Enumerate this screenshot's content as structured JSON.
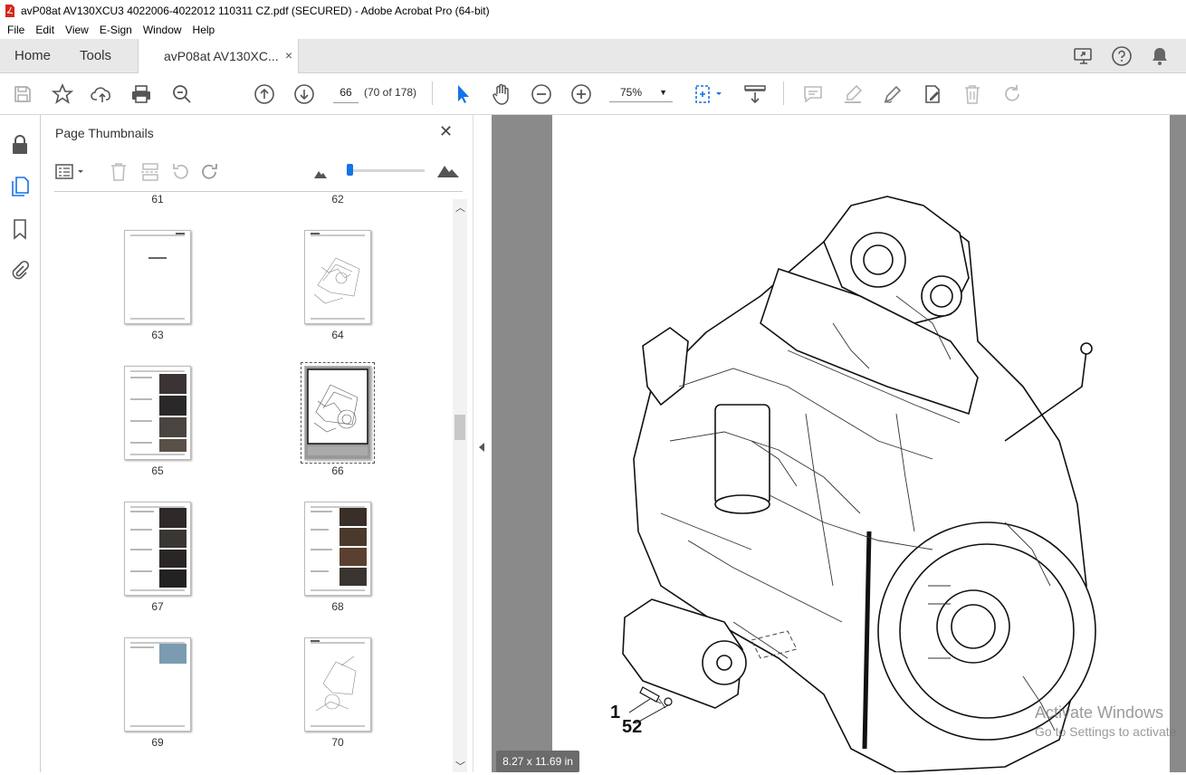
{
  "window": {
    "title": "avP08at AV130XCU3 4022006-4022012 110311 CZ.pdf (SECURED) - Adobe Acrobat Pro (64-bit)"
  },
  "menu": [
    "File",
    "Edit",
    "View",
    "E-Sign",
    "Window",
    "Help"
  ],
  "tabs": {
    "home": "Home",
    "tools": "Tools",
    "doc": "avP08at AV130XC...",
    "close": "×"
  },
  "toolbar": {
    "page_number": "66",
    "page_of": "(70 of 178)",
    "zoom": "75%"
  },
  "panel": {
    "title": "Page Thumbnails",
    "close": "✕",
    "thumbnails": [
      {
        "label": "61"
      },
      {
        "label": "62"
      },
      {
        "label": "63"
      },
      {
        "label": "64"
      },
      {
        "label": "65"
      },
      {
        "label": "66",
        "selected": true
      },
      {
        "label": "67"
      },
      {
        "label": "68"
      },
      {
        "label": "69"
      },
      {
        "label": "70"
      }
    ]
  },
  "status": {
    "page_size": "8.27 x 11.69 in"
  },
  "document": {
    "callouts": [
      "1",
      "52"
    ]
  },
  "watermark": {
    "line1": "Activate Windows",
    "line2": "Go to Settings to activate"
  },
  "colors": {
    "accent": "#1473e6",
    "pdf_red": "#d4261c",
    "page_bg": "#8a8a8a"
  }
}
